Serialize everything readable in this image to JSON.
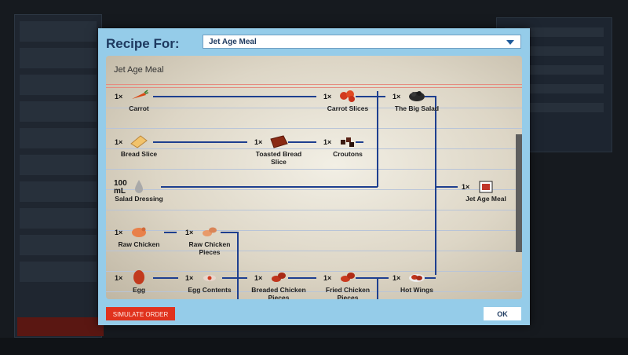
{
  "dialog": {
    "title": "Recipe For:",
    "selected_recipe": "Jet Age Meal",
    "simulate_label": "SIMULATE ORDER",
    "ok_label": "OK"
  },
  "recipe": {
    "title": "Jet Age Meal",
    "nodes": [
      {
        "id": "carrot",
        "qty": "1×",
        "label": "Carrot",
        "icon": "carrot-icon"
      },
      {
        "id": "carrot_slices",
        "qty": "1×",
        "label": "Carrot Slices",
        "icon": "carrot-slices-icon"
      },
      {
        "id": "big_salad",
        "qty": "1×",
        "label": "The Big Salad",
        "icon": "salad-icon"
      },
      {
        "id": "bread_slice",
        "qty": "1×",
        "label": "Bread Slice",
        "icon": "bread-slice-icon"
      },
      {
        "id": "toasted_bread",
        "qty": "1×",
        "label": "Toasted Bread Slice",
        "icon": "toasted-bread-icon"
      },
      {
        "id": "croutons",
        "qty": "1×",
        "label": "Croutons",
        "icon": "croutons-icon"
      },
      {
        "id": "salad_dressing",
        "qty": "100 mL",
        "label": "Salad Dressing",
        "icon": "dressing-drop-icon"
      },
      {
        "id": "jet_age_meal",
        "qty": "1×",
        "label": "Jet Age Meal",
        "icon": "meal-box-icon"
      },
      {
        "id": "raw_chicken",
        "qty": "1×",
        "label": "Raw Chicken",
        "icon": "raw-chicken-icon"
      },
      {
        "id": "raw_chicken_pieces",
        "qty": "1×",
        "label": "Raw Chicken Pieces",
        "icon": "chicken-pieces-icon"
      },
      {
        "id": "egg",
        "qty": "1×",
        "label": "Egg",
        "icon": "egg-icon"
      },
      {
        "id": "egg_contents",
        "qty": "1×",
        "label": "Egg Contents",
        "icon": "egg-contents-icon"
      },
      {
        "id": "breaded_chicken",
        "qty": "1×",
        "label": "Breaded Chicken Pieces",
        "icon": "breaded-chicken-icon"
      },
      {
        "id": "fried_chicken",
        "qty": "1×",
        "label": "Fried Chicken Pieces",
        "icon": "fried-chicken-icon"
      },
      {
        "id": "hot_wings",
        "qty": "1×",
        "label": "Hot Wings",
        "icon": "hot-wings-icon"
      }
    ]
  },
  "colors": {
    "dialog_bg": "#95cce9",
    "link_line": "#1e3f8f",
    "simulate_button": "#e0321d"
  }
}
